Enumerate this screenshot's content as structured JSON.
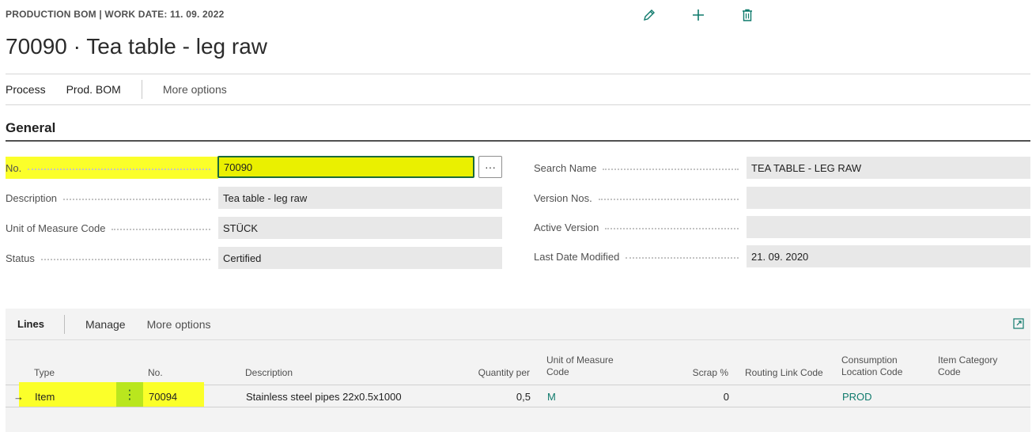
{
  "header": {
    "caption": "PRODUCTION BOM | WORK DATE: 11. 09. 2022",
    "title": "70090 · Tea table - leg raw",
    "icons": [
      "edit-icon",
      "add-icon",
      "delete-icon"
    ]
  },
  "actions": {
    "process": "Process",
    "prod_bom": "Prod. BOM",
    "more_options": "More options"
  },
  "general": {
    "title": "General",
    "left_fields": [
      {
        "label": "No.",
        "value": "70090"
      },
      {
        "label": "Description",
        "value": "Tea table - leg raw"
      },
      {
        "label": "Unit of Measure Code",
        "value": "STÜCK"
      },
      {
        "label": "Status",
        "value": "Certified"
      }
    ],
    "lookup_label": "···",
    "right_fields": [
      {
        "label": "Search Name",
        "value": "TEA TABLE - LEG RAW"
      },
      {
        "label": "Version Nos.",
        "value": ""
      },
      {
        "label": "Active Version",
        "value": ""
      },
      {
        "label": "Last Date Modified",
        "value": "21. 09. 2020"
      }
    ]
  },
  "lines": {
    "tab": "Lines",
    "manage": "Manage",
    "more_options": "More options",
    "columns": {
      "type": "Type",
      "no": "No.",
      "description": "Description",
      "quantity_per": "Quantity per",
      "uom_line1": "Unit of Measure",
      "uom_line2": "Code",
      "scrap": "Scrap %",
      "routing_link": "Routing Link Code",
      "cons_loc_line1": "Consumption",
      "cons_loc_line2": "Location Code",
      "item_cat_line1": "Item Category",
      "item_cat_line2": "Code"
    },
    "rows": [
      {
        "indicator": "→",
        "type": "Item",
        "no": "70094",
        "description": "Stainless steel pipes 22x0.5x1000",
        "quantity_per": "0,5",
        "uom": "M",
        "scrap": "0",
        "routing_link": "",
        "consumption_location": "PROD",
        "item_category": ""
      }
    ]
  },
  "colors": {
    "accent": "#0f7a6c",
    "highlight": "#fbff2a",
    "focus_border": "#1c6b3a"
  }
}
